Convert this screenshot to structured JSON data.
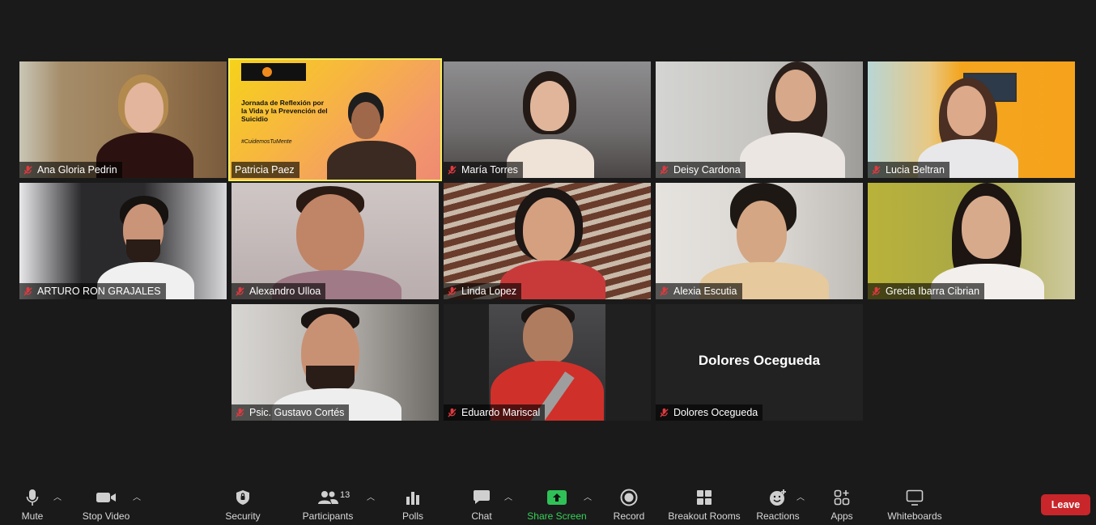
{
  "participants_grid": [
    {
      "name": "Ana Gloria Pedrin",
      "muted": true
    },
    {
      "name": "Patricia Paez",
      "muted": false,
      "active_speaker": true,
      "slide": {
        "title": "Jornada de Reflexión por la Vida y la Prevención del Suicidio",
        "hashtag": "#CuidemosTuMente"
      }
    },
    {
      "name": "María Torres",
      "muted": true
    },
    {
      "name": "Deisy Cardona",
      "muted": true
    },
    {
      "name": "Lucia Beltran",
      "muted": true
    },
    {
      "name": "ARTURO RON GRAJALES",
      "muted": true
    },
    {
      "name": "Alexandro Ulloa",
      "muted": true
    },
    {
      "name": "Linda Lopez",
      "muted": true
    },
    {
      "name": "Alexia Escutia",
      "muted": true
    },
    {
      "name": "Grecia Ibarra Cibrian",
      "muted": true
    },
    {
      "name": "Psic. Gustavo Cortés",
      "muted": true
    },
    {
      "name": "Eduardo Mariscal",
      "muted": true
    },
    {
      "name": "Dolores Ocegueda",
      "muted": true,
      "video_off": true,
      "display_name": "Dolores Ocegueda"
    }
  ],
  "toolbar": {
    "mute": "Mute",
    "stop_video": "Stop Video",
    "security": "Security",
    "participants": "Participants",
    "participants_count": "13",
    "polls": "Polls",
    "chat": "Chat",
    "share_screen": "Share Screen",
    "record": "Record",
    "breakout_rooms": "Breakout Rooms",
    "reactions": "Reactions",
    "apps": "Apps",
    "whiteboards": "Whiteboards",
    "leave": "Leave"
  },
  "colors": {
    "background": "#1a1a1a",
    "active_speaker_border": "#f3ee5d",
    "share_green": "#37d159",
    "leave_red": "#c8262a",
    "muted_icon": "#e0393e"
  }
}
